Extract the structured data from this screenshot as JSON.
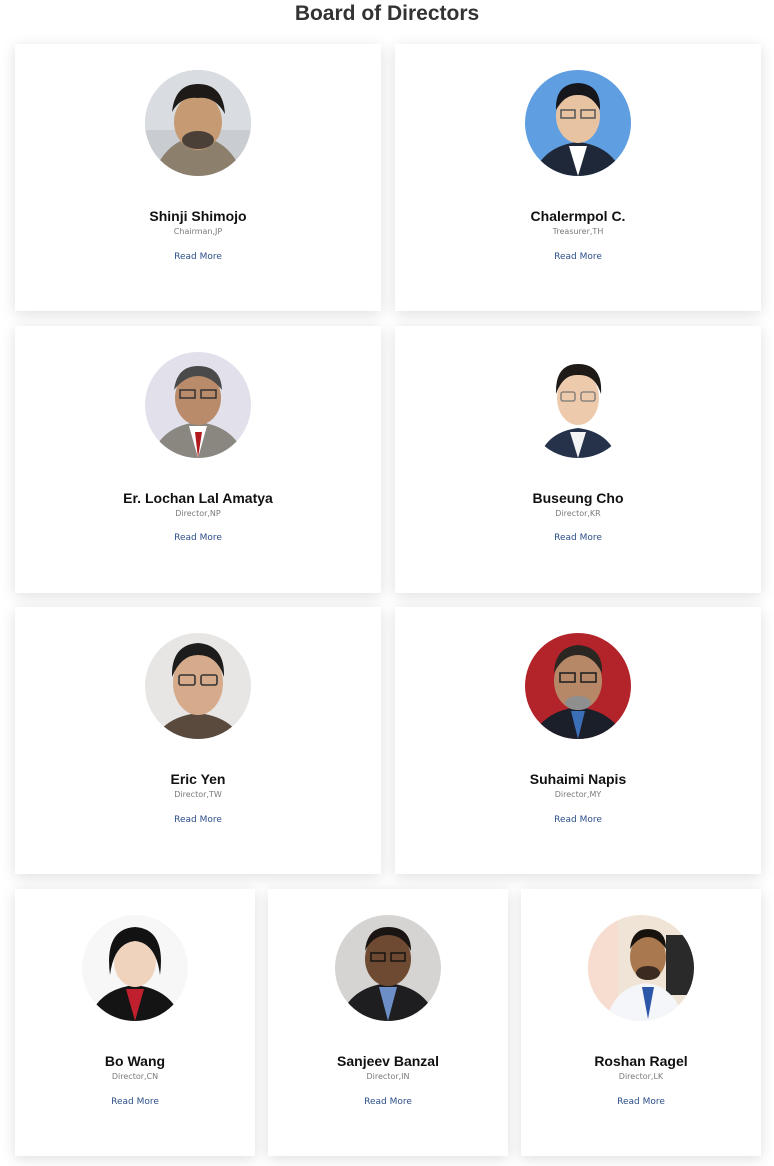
{
  "section": {
    "title": "Board of Directors"
  },
  "directors": [
    {
      "name": "Shinji Shimojo",
      "role": "Chairman,JP",
      "link": "Read More"
    },
    {
      "name": "Chalermpol C.",
      "role": "Treasurer,TH",
      "link": "Read More"
    },
    {
      "name": "Er. Lochan Lal Amatya",
      "role": "Director,NP",
      "link": "Read More"
    },
    {
      "name": "Buseung Cho",
      "role": "Director,KR",
      "link": "Read More"
    },
    {
      "name": "Eric Yen",
      "role": "Director,TW",
      "link": "Read More"
    },
    {
      "name": "Suhaimi Napis",
      "role": "Director,MY",
      "link": "Read More"
    },
    {
      "name": "Bo Wang",
      "role": "Director,CN",
      "link": "Read More"
    },
    {
      "name": "Sanjeev Banzal",
      "role": "Director,IN",
      "link": "Read More"
    },
    {
      "name": "Roshan Ragel",
      "role": "Director,LK",
      "link": "Read More"
    }
  ],
  "colors": {
    "link": "#2c4f8a",
    "title": "#333333",
    "role": "#7a7a7a"
  }
}
